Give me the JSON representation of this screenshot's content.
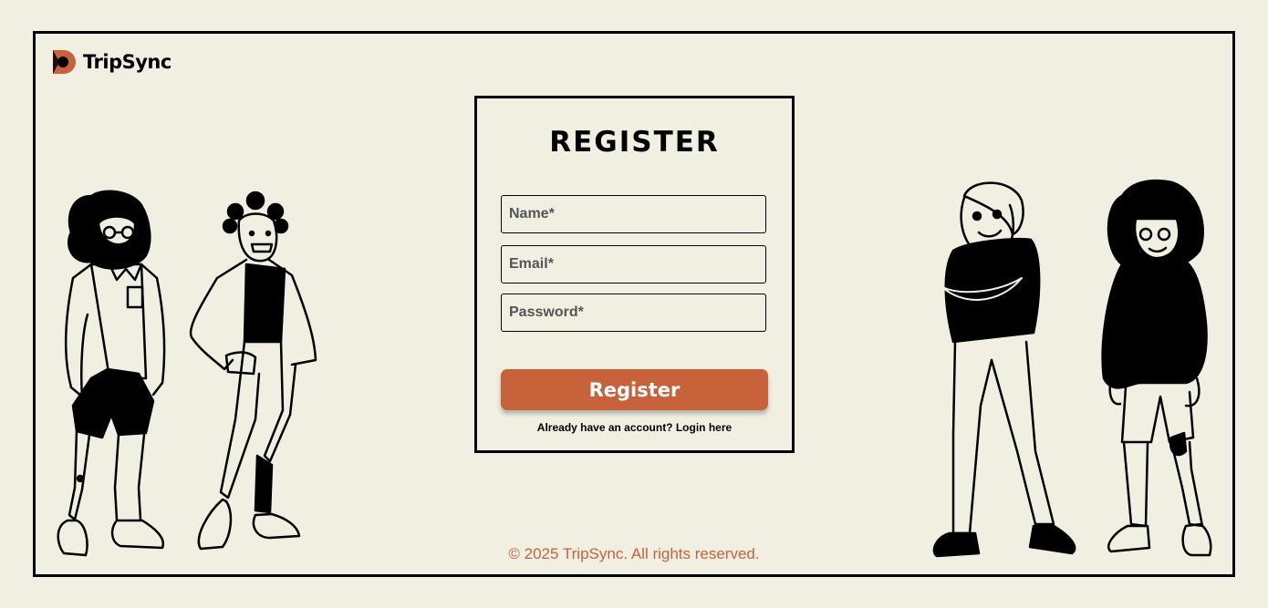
{
  "brand": {
    "name": "TripSync",
    "logo_icon": "tripsync-logo-icon",
    "accent": "#c8623a"
  },
  "form": {
    "title": "REGISTER",
    "name_placeholder": "Name*",
    "email_placeholder": "Email*",
    "password_placeholder": "Password*",
    "submit_label": "Register",
    "login_prompt": "Already have an account? Login here"
  },
  "footer": {
    "text": "© 2025 TripSync. All rights reserved."
  },
  "colors": {
    "background": "#f0efe2",
    "accent": "#c8623a",
    "ink": "#000000"
  }
}
